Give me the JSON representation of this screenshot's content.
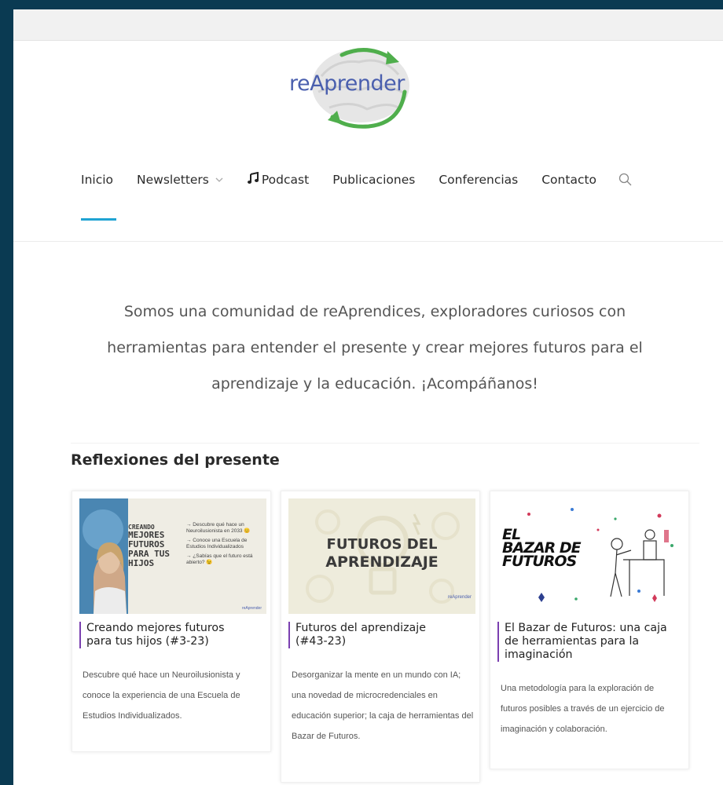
{
  "brand": {
    "logo_text": "reAprender"
  },
  "nav": {
    "items": [
      {
        "label": "Inicio",
        "active": true
      },
      {
        "label": "Newsletters",
        "has_dropdown": true
      },
      {
        "label": "Podcast",
        "icon": "music-note-icon"
      },
      {
        "label": "Publicaciones"
      },
      {
        "label": "Conferencias"
      },
      {
        "label": "Contacto"
      }
    ],
    "search_icon": "search-icon",
    "accent_color": "#1fa3d3"
  },
  "intro": {
    "lines": [
      "Somos una comunidad de reAprendices, exploradores curiosos con",
      "herramientas para entender el presente y crear mejores futuros para el",
      "aprendizaje y la educación. ¡Acompáñanos!"
    ]
  },
  "section": {
    "title": "Reflexiones del presente"
  },
  "cards": [
    {
      "title": "Creando mejores futuros para tus hijos (#3-23)",
      "excerpt": "Descubre qué hace un Neuroilusionista y conoce la experiencia de una Escuela de Estudios Individualizados.",
      "image": {
        "heading_lines": [
          "CREANDO",
          "MEJORES",
          "FUTUROS",
          "PARA TUS",
          "HIJOS"
        ],
        "bullets": [
          "→ Descubre qué hace un Neuroilusionista en 2033 😊",
          "→ Conoce una Escuela de Estudios Individualizados",
          "→ ¿Sabías que el futuro está abierto? 😉"
        ],
        "brand": "reAprender"
      }
    },
    {
      "title": "Futuros del aprendizaje (#43-23)",
      "excerpt": "Desorganizar la mente en un mundo con IA; una novedad de microcredenciales en educación superior; la caja de herramientas del Bazar de Futuros.",
      "image": {
        "heading_lines": [
          "FUTUROS DEL",
          "APRENDIZAJE"
        ],
        "brand": "reAprender"
      }
    },
    {
      "title": "El Bazar de Futuros: una caja de herramientas para la imaginación",
      "excerpt": "Una metodología para la exploración de futuros posibles a través de un ejercicio de imaginación y colaboración.",
      "image": {
        "heading_lines": [
          "EL",
          "BAZAR DE",
          "FUTUROS"
        ]
      }
    }
  ],
  "colors": {
    "card_title_bar": "#7a3fb0",
    "frame_background": "#0a3a52"
  }
}
